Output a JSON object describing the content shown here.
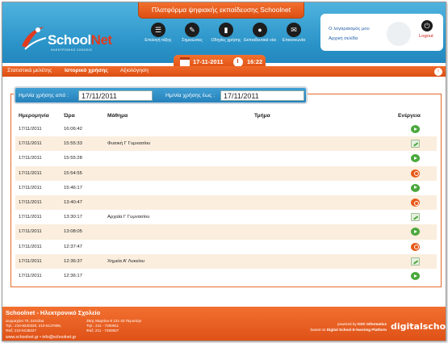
{
  "header": {
    "platform_title": "Πλατφόρμα ψηφιακής εκπαίδευσης Schoolnet",
    "logo_school": "School",
    "logo_net": "Net",
    "logo_sub": "ΗΛΕΚΤΡΟΝΙΚΟ ΣΧΟΛΕΙΟ",
    "nav": [
      {
        "icon": "list-icon",
        "label": "Επιλογή τάξης"
      },
      {
        "icon": "pencil-icon",
        "label": "Σημειώσεις"
      },
      {
        "icon": "book-icon",
        "label": "Οδηγίες χρήσης"
      },
      {
        "icon": "chat-icon",
        "label": "Εκπαιδευτικά νέα"
      },
      {
        "icon": "mail-icon",
        "label": "Επικοινωνία"
      }
    ],
    "account_link": "Ο λογαριασμός μου",
    "home_link": "Αρχική σελίδα",
    "logout_label": "Logout",
    "date": "17-11-2011",
    "time": "16:22"
  },
  "subnav": {
    "items": [
      {
        "label": "Στατιστικά μελέτης",
        "active": false
      },
      {
        "label": "Ιστορικό χρήσης",
        "active": true
      },
      {
        "label": "Αξιολόγηση",
        "active": false
      }
    ],
    "up_icon": "arrow-up-icon"
  },
  "filter": {
    "from_label": "Ημ/νία χρήσης από :",
    "from_value": "17/11/2011",
    "to_label": "Ημ/νία χρήσης έως :",
    "to_value": "17/11/2011"
  },
  "table": {
    "headers": [
      "Ημερομηνία",
      "Ώρα",
      "Μάθημα",
      "Τμήμα",
      "Ενέργεια"
    ],
    "rows": [
      {
        "date": "17/11/2011",
        "time": "16:06:42",
        "lesson": "",
        "section": "",
        "action": "login"
      },
      {
        "date": "17/11/2011",
        "time": "15:55:33",
        "lesson": "Φυσική Γ Γυμνασίου",
        "section": "",
        "action": "edit"
      },
      {
        "date": "17/11/2011",
        "time": "15:55:28",
        "lesson": "",
        "section": "",
        "action": "login"
      },
      {
        "date": "17/11/2011",
        "time": "15:54:55",
        "lesson": "",
        "section": "",
        "action": "logout"
      },
      {
        "date": "17/11/2011",
        "time": "15:46:17",
        "lesson": "",
        "section": "",
        "action": "login"
      },
      {
        "date": "17/11/2011",
        "time": "13:40:47",
        "lesson": "",
        "section": "",
        "action": "logout"
      },
      {
        "date": "17/11/2011",
        "time": "13:30:17",
        "lesson": "Αρχαία Γ Γυμνασίου",
        "section": "",
        "action": "edit"
      },
      {
        "date": "17/11/2011",
        "time": "13:08:05",
        "lesson": "",
        "section": "",
        "action": "login"
      },
      {
        "date": "17/11/2011",
        "time": "12:37:47",
        "lesson": "",
        "section": "",
        "action": "logout"
      },
      {
        "date": "17/11/2011",
        "time": "12:36:37",
        "lesson": "Χημεία Α' Λυκείου",
        "section": "",
        "action": "edit"
      },
      {
        "date": "17/11/2011",
        "time": "12:36:17",
        "lesson": "",
        "section": "",
        "action": "login"
      }
    ]
  },
  "footer": {
    "title": "Schoolnet - Ηλεκτρονικό Σχολείο",
    "addr1_line1": "Δυρραχίου 70, Σεπόλια",
    "addr1_line2": "Τηλ.: 210-8220320, 210-5137806,",
    "addr1_line3": "Φαξ: 210-5138227",
    "addr2_line1": "25ης Μαρτίου 8 121-32 Περιστέρι",
    "addr2_line2": "Τηλ.: 211 - 7250911",
    "addr2_line3": "Φαξ: 211 - 7250927",
    "links": "www.schoolnet.gr • info@schoolnet.gr",
    "powered_by": "powered by",
    "kdc": "KDC Informatics",
    "based_on": "based on",
    "platform": "Digital School E-learning Platform",
    "ds_logo": "digitalschool"
  }
}
